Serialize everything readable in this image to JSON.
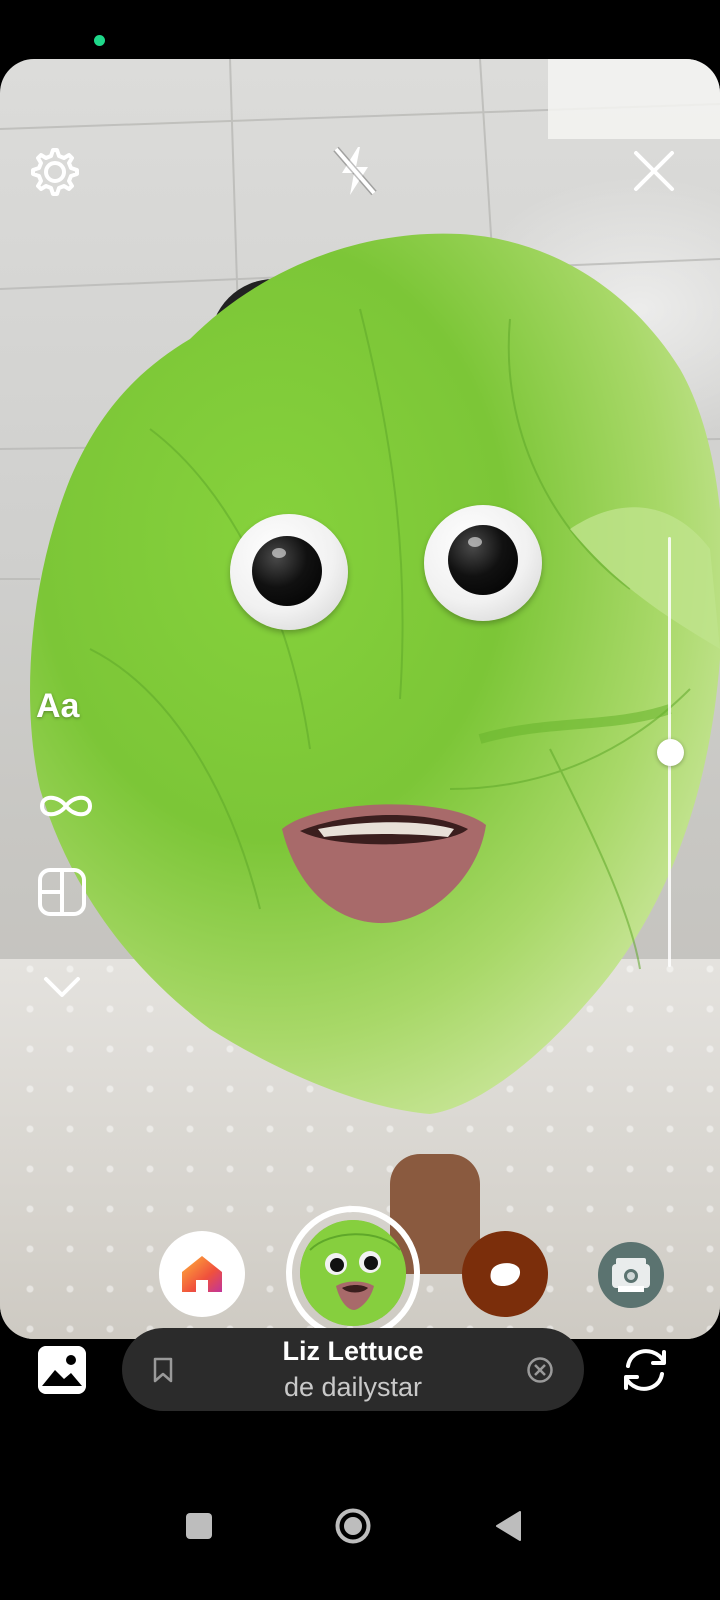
{
  "filter": {
    "name": "Liz Lettuce",
    "author": "de dailystar"
  },
  "left_tools": {
    "text_label": "Aa"
  },
  "top_bar": {
    "settings_icon": "gear-icon",
    "flash_icon": "flash-off-icon",
    "close_icon": "close-icon"
  },
  "effects_tray": [
    "home-effect",
    "liz-lettuce-effect",
    "donut-effect",
    "polaroid-effect"
  ],
  "zoom": {
    "level_fraction": 0.47
  },
  "colors": {
    "status_dot": "#1fd88a",
    "lettuce": "#7fc63b",
    "donut_effect": "#7b2e0b",
    "polaroid_effect": "#5b7370",
    "pill": "#2b2b2b"
  }
}
